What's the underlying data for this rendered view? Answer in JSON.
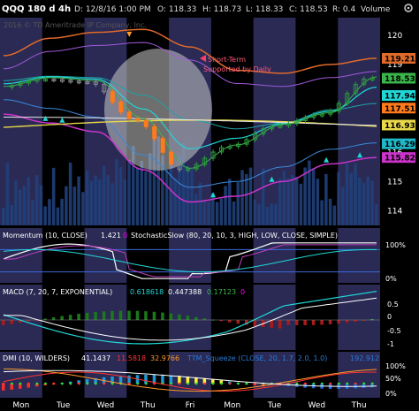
{
  "header": {
    "symbol": "QQQ 180 d 4h",
    "date": "D: 12/8/16 1:00 PM",
    "open": "O: 118.33",
    "high": "H: 118.73",
    "low": "L: 118.33",
    "close": "C: 118.53",
    "range": "R: 0.4",
    "volume_label": "Volume",
    "copyright": "2016 © TD Ameritrade IP Company, Inc."
  },
  "annotation": {
    "line1": "Short-Term",
    "line2": "Supported by Daily"
  },
  "colors": {
    "band_upper": "#e06a2a",
    "band_lower": "#cc33cc",
    "accent_orange": "#ff7a1a",
    "ma_yellow": "#e8d84a",
    "ma_cyan": "#22d6d6",
    "ma_teal": "#1fa3a3",
    "ma_purple": "#a05ad8",
    "ma_blue": "#3a8ad8",
    "ma_green": "#3ab54a",
    "volume": "#20407a",
    "bg_band": "#2a2a55",
    "ellipse": "#c8c8c8"
  },
  "price_labels": [
    {
      "v": 120,
      "text": "120"
    },
    {
      "v": 119,
      "text": "119"
    },
    {
      "v": 118,
      "text": "118"
    },
    {
      "v": 117,
      "text": "117"
    },
    {
      "v": 116,
      "text": "116"
    },
    {
      "v": 115,
      "text": "115"
    },
    {
      "v": 114,
      "text": "114"
    }
  ],
  "price_tags": [
    {
      "v": 119.21,
      "text": "119.21",
      "color": "#e06a2a"
    },
    {
      "v": 118.53,
      "text": "118.53",
      "color": "#3ab54a"
    },
    {
      "v": 117.94,
      "text": "117.94",
      "color": "#22d6d6"
    },
    {
      "v": 117.51,
      "text": "117.51",
      "color": "#ff7a1a"
    },
    {
      "v": 116.93,
      "text": "116.93",
      "color": "#e8d84a"
    },
    {
      "v": 116.29,
      "text": "116.29",
      "color": "#1fb8c8"
    },
    {
      "v": 115.82,
      "text": "115.82",
      "color": "#cc33cc"
    }
  ],
  "momentum": {
    "label": "Momentum (10, CLOSE)",
    "value": "1.421",
    "zero": "0",
    "stoch_label": "StochasticSlow (80, 20, 10, 3, HIGH, LOW, CLOSE, SIMPLE)",
    "ticks": [
      "100%",
      "0%"
    ]
  },
  "macd": {
    "label": "MACD (7, 20, 7, EXPONENTIAL)",
    "v1": "0.618618",
    "v2": "0.447388",
    "v3": "0.17123",
    "v4": "0",
    "ticks": [
      "0.5",
      "0",
      "-0.5",
      "-1"
    ]
  },
  "dmi": {
    "label": "DMI (10, WILDERS)",
    "v1": "41.1437",
    "v2": "11.5818",
    "v3": "32.9766",
    "ttm": "TTM_Squeeze (CLOSE, 20, 1.7, 2.0, 1.0)",
    "ttm_val": "192.912",
    "ticks": [
      "100%",
      "50%",
      "0%"
    ]
  },
  "x_axis": [
    "Mon",
    "Tue",
    "Wed",
    "Thu",
    "Fri",
    "Mon",
    "Tue",
    "Wed",
    "Thu"
  ],
  "chart_data": {
    "type": "line",
    "title": "QQQ 180 d 4h",
    "x": [
      "Mon",
      "Tue",
      "Wed",
      "Thu",
      "Fri",
      "Mon",
      "Tue",
      "Wed",
      "Thu"
    ],
    "ylim": [
      113.5,
      120.6
    ],
    "series": [
      {
        "name": "Close",
        "values": [
          118.2,
          118.5,
          118.4,
          117.1,
          115.4,
          116.2,
          116.9,
          117.3,
          118.53
        ]
      },
      {
        "name": "Upper band",
        "values": [
          119.3,
          119.9,
          120.1,
          120.2,
          119.6,
          118.8,
          118.7,
          119.0,
          119.21
        ]
      },
      {
        "name": "Lower band",
        "values": [
          117.3,
          117.0,
          116.7,
          115.4,
          114.3,
          114.5,
          115.0,
          115.6,
          115.82
        ]
      }
    ],
    "momentum": {
      "value": 1.421
    },
    "macd": {
      "macd": 0.618618,
      "signal": 0.447388,
      "hist": 0.17123
    },
    "dmi": {
      "adx": 41.1437,
      "di_minus": 11.5818,
      "di_plus": 32.9766
    }
  }
}
